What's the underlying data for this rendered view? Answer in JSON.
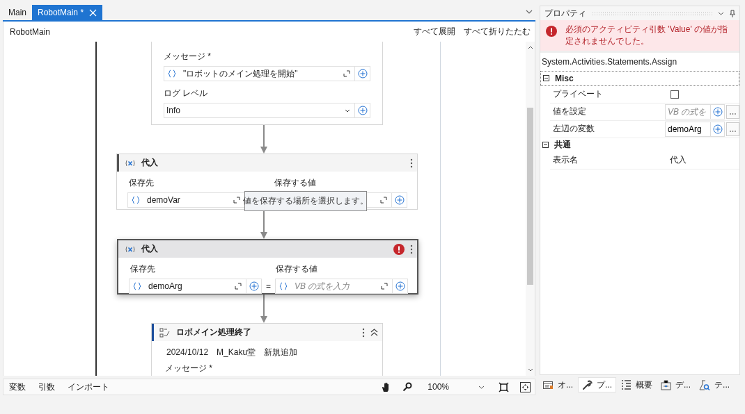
{
  "document_tabs": [
    {
      "label": "Main",
      "selected": false,
      "closable": false
    },
    {
      "label": "RobotMain *",
      "selected": true,
      "closable": true
    }
  ],
  "designer": {
    "breadcrumb": "RobotMain",
    "actions": [
      "すべて展開",
      "すべて折りたたむ"
    ],
    "activities": [
      {
        "kind": "log",
        "message_label": "メッセージ *",
        "message_value": "\"ロボットのメイン処理を開始\"",
        "level_label": "ログ レベル",
        "level_value": "Info"
      },
      {
        "kind": "assign",
        "title": "代入",
        "selected": false,
        "error": false,
        "to_label": "保存先",
        "to_value": "demoVar",
        "value_label": "保存する値",
        "tooltip": "値を保存する場所を選択します。"
      },
      {
        "kind": "assign",
        "title": "代入",
        "selected": true,
        "error": true,
        "to_label": "保存先",
        "to_value": "demoArg",
        "operator": "=",
        "value_label": "保存する値",
        "value_placeholder": "VB の式を入力"
      },
      {
        "kind": "sequence",
        "title": "ロボメイン処理終了",
        "annotation": "2024/10/12　M_Kaku堂　新規追加",
        "field_label": "メッセージ *"
      }
    ]
  },
  "status_bar": {
    "links": [
      "変数",
      "引数",
      "インポート"
    ],
    "zoom": "100%"
  },
  "properties": {
    "title": "プロパティ",
    "error": "必須のアクティビティ引数 'Value' の値が指定されませんでした。",
    "type_name": "System.Activities.Statements.Assign",
    "categories": [
      {
        "name": "Misc",
        "expanded": true,
        "rows": [
          {
            "label": "プライベート",
            "kind": "checkbox",
            "checked": false
          },
          {
            "label": "値を設定",
            "kind": "expression",
            "placeholder": "VB の式を"
          },
          {
            "label": "左辺の変数",
            "kind": "expression",
            "value": "demoArg"
          }
        ]
      },
      {
        "name": "共通",
        "expanded": true,
        "rows": [
          {
            "label": "表示名",
            "kind": "text",
            "value": "代入"
          }
        ]
      }
    ]
  },
  "panel_tabs": [
    {
      "label": "オ...",
      "selected": false
    },
    {
      "label": "プ...",
      "selected": true
    },
    {
      "label": "概要",
      "selected": false
    },
    {
      "label": "デ...",
      "selected": false
    },
    {
      "label": "テ...",
      "selected": false
    }
  ]
}
